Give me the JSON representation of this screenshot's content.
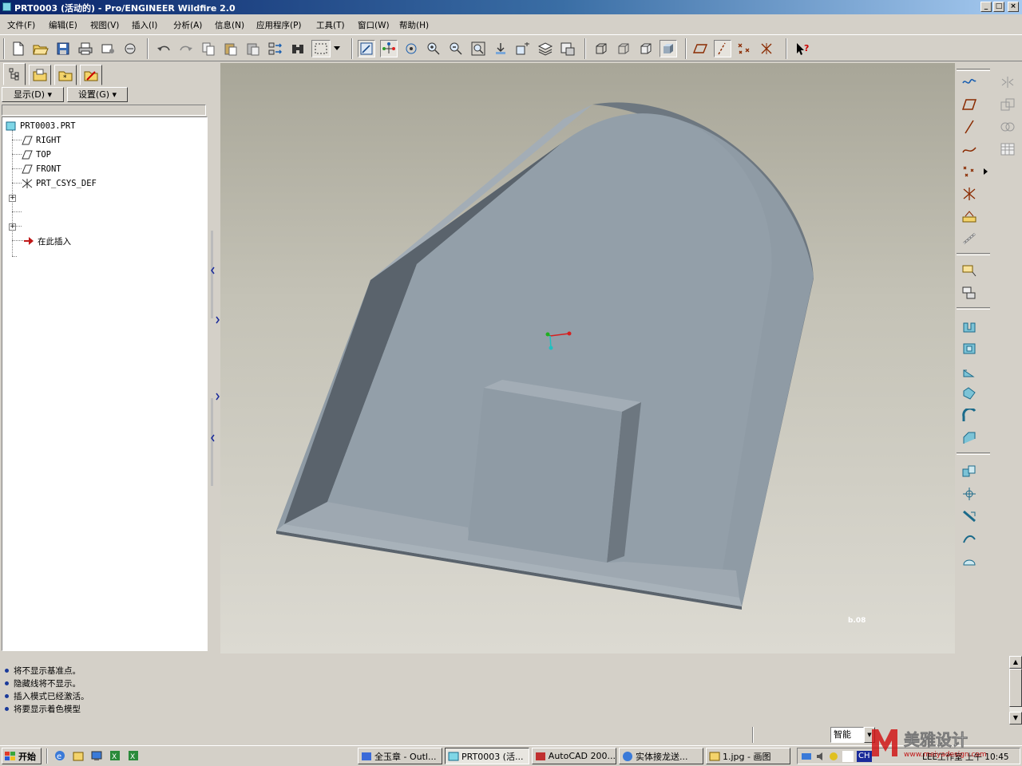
{
  "window": {
    "title": "PRT0003 (活动的) - Pro/ENGINEER Wildfire 2.0",
    "controls": [
      "_",
      "□",
      "×"
    ]
  },
  "menu": [
    "文件(F)",
    "编辑(E)",
    "视图(V)",
    "插入(I)",
    "分析(A)",
    "信息(N)",
    "应用程序(P)",
    "工具(T)",
    "窗口(W)",
    "帮助(H)"
  ],
  "navigator": {
    "show_button": "显示(D) ▾",
    "settings_button": "设置(G) ▾",
    "tree": {
      "root": "PRT0003.PRT",
      "items": [
        "RIGHT",
        "TOP",
        "FRONT",
        "PRT_CSYS_DEF"
      ],
      "insert_here": "在此插入"
    }
  },
  "viewport": {
    "model_colors": {
      "front_face": "#8f9ba5",
      "side_face": "#6d7780",
      "top_face": "#a3adb6",
      "pocket_wall": "#5a636c"
    },
    "corner_mark": "b.08"
  },
  "messages": [
    "将不显示基准点。",
    "隐藏线将不显示。",
    "插入模式已经激活。",
    "将要显示着色模型"
  ],
  "status": {
    "filter_value": "智能"
  },
  "taskbar": {
    "start": "开始",
    "tasks": [
      "全玉章 - Outl...",
      "PRT0003 (活...",
      "AutoCAD 200...",
      "实体接龙送...",
      "1.jpg - 画图"
    ],
    "tray_text": "LEE工作室  上午 10:45",
    "ime": "CH"
  },
  "watermark": {
    "brand": "美雅设计",
    "url": "www.meiyadesign.com"
  }
}
